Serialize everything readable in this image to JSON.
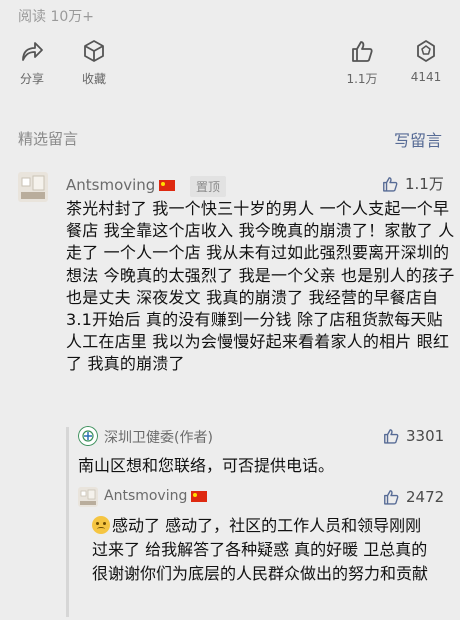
{
  "header": {
    "read_count": "阅读 10万+",
    "actions": [
      {
        "icon": "share-icon",
        "label": "分享"
      },
      {
        "icon": "favorite-cube-icon",
        "label": "收藏"
      },
      {
        "icon": "thumb-up-icon",
        "label": "1.1万"
      },
      {
        "icon": "wow-icon",
        "label": "4141"
      }
    ]
  },
  "comments_section": {
    "title": "精选留言",
    "write_label": "写留言"
  },
  "comment": {
    "author": "Antsmoving",
    "pinned_label": "置顶",
    "likes": "1.1万",
    "text": "茶光村封了 我一个快三十岁的男人 一个人支起一个早餐店 我全靠这个店收入 我今晚真的崩溃了！家散了 人走了 一个人一个店 我从未有过如此强烈要离开深圳的想法 今晚真的太强烈了 我是一个父亲 也是别人的孩子 也是丈夫 深夜发文 我真的崩溃了 我经营的早餐店自3.1开始后 真的没有赚到一分钱 除了店租货款每天贴人工在店里 我以为会慢慢好起来看着家人的相片 眼红了 我真的崩溃了"
  },
  "replies": [
    {
      "author": "深圳卫健委(作者)",
      "likes": "3301",
      "text": "南山区想和您联络，可否提供电话。"
    },
    {
      "author": "Antsmoving",
      "likes": "2472",
      "text": "感动了 感动了，社区的工作人员和领导刚刚过来了 给我解答了各种疑惑 真的好暖 卫总真的很谢谢你们为底层的人民群众做出的努力和贡献"
    }
  ],
  "colors": {
    "link": "#576b95",
    "background": "#ededed"
  }
}
